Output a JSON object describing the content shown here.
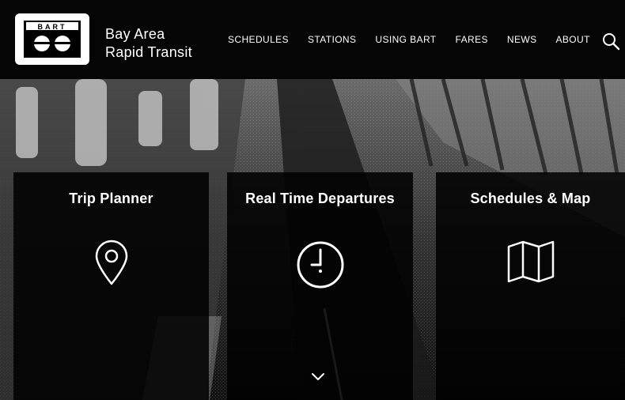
{
  "header": {
    "logo_text": "BART",
    "title_line1": "Bay Area",
    "title_line2": "Rapid Transit"
  },
  "nav": {
    "items": [
      "SCHEDULES",
      "STATIONS",
      "USING BART",
      "FARES",
      "NEWS",
      "ABOUT"
    ]
  },
  "panels": [
    {
      "title": "Trip Planner",
      "icon": "map-pin-icon"
    },
    {
      "title": "Real Time Departures",
      "icon": "clock-icon"
    },
    {
      "title": "Schedules & Map",
      "icon": "folded-map-icon"
    }
  ],
  "icons": {
    "search": "search-icon",
    "scroll": "chevron-down-icon"
  },
  "colors": {
    "header_bg": "#050505",
    "panel_bg": "#000000",
    "text": "#ffffff"
  }
}
